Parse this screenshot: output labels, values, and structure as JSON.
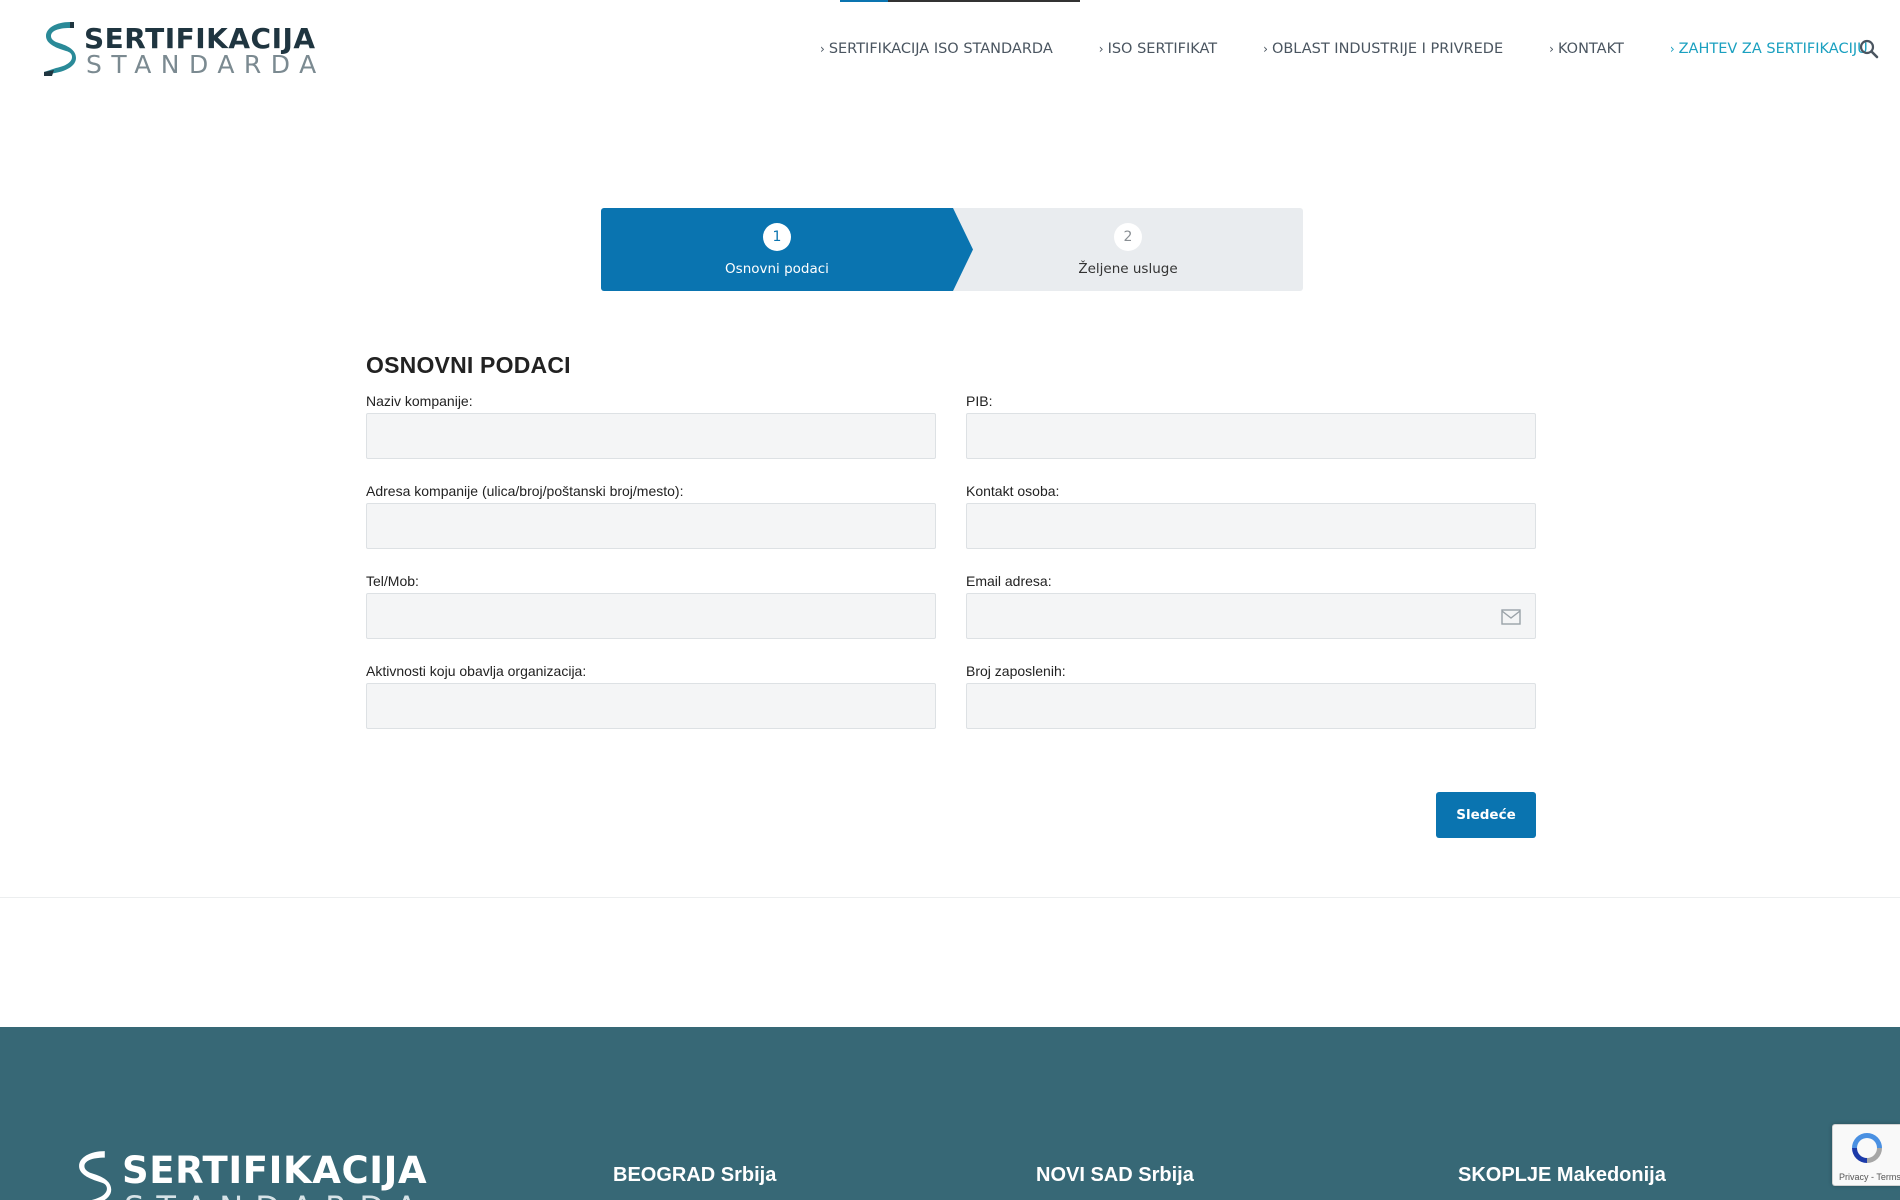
{
  "header": {
    "logo": {
      "line1": "SERTIFIKACIJA",
      "line2": "STANDARDA"
    },
    "nav": [
      {
        "label": "SERTIFIKACIJA ISO STANDARDA",
        "active": false
      },
      {
        "label": "ISO SERTIFIKAT",
        "active": false
      },
      {
        "label": "OBLAST INDUSTRIJE I PRIVREDE",
        "active": false
      },
      {
        "label": "KONTAKT",
        "active": false
      },
      {
        "label": "ZAHTEV ZA SERTIFIKACIJU",
        "active": true
      }
    ],
    "search_icon": "search-icon"
  },
  "stepper": {
    "steps": [
      {
        "number": "1",
        "label": "Osnovni podaci",
        "active": true
      },
      {
        "number": "2",
        "label": "Željene usluge",
        "active": false
      }
    ]
  },
  "form": {
    "title": "OSNOVNI PODACI",
    "fields": {
      "company_name": {
        "label": "Naziv kompanije:",
        "value": ""
      },
      "pib": {
        "label": "PIB:",
        "value": ""
      },
      "company_address": {
        "label": "Adresa kompanije (ulica/broj/poštanski broj/mesto):",
        "value": ""
      },
      "contact_person": {
        "label": "Kontakt osoba:",
        "value": ""
      },
      "phone": {
        "label": "Tel/Mob:",
        "value": ""
      },
      "email": {
        "label": "Email adresa:",
        "value": "",
        "icon": "mail-icon"
      },
      "activities": {
        "label": "Aktivnosti koju obavlja organizacija:",
        "value": ""
      },
      "employees": {
        "label": "Broj zaposlenih:",
        "value": ""
      }
    },
    "next_label": "Sledeće"
  },
  "footer": {
    "logo": {
      "line1": "SERTIFIKACIJA",
      "line2": "STANDARDA"
    },
    "cities": [
      "BEOGRAD Srbija",
      "NOVI SAD Srbija",
      "SKOPLJE Makedonija"
    ]
  },
  "recaptcha": {
    "text": "Privacy - Terms"
  },
  "colors": {
    "primary": "#0a74b0",
    "accent": "#1aa0c0",
    "footer_bg": "#376876",
    "logo_dark": "#1f3540",
    "logo_teal": "#2a8a98"
  }
}
